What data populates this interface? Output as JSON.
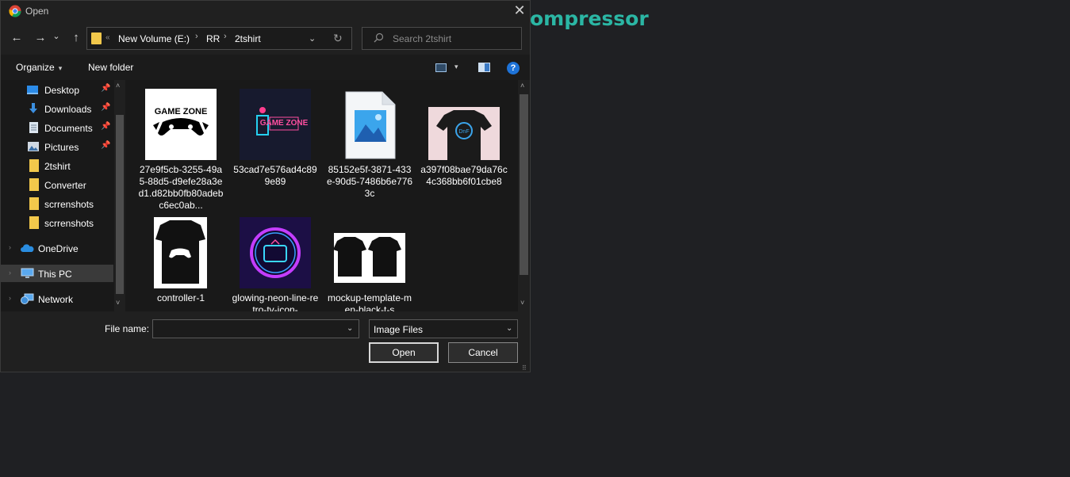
{
  "background": {
    "heading": "ompressor"
  },
  "dialog": {
    "title": "Open",
    "close_glyph": "✕"
  },
  "nav": {
    "back_glyph": "←",
    "forward_glyph": "→",
    "recent_glyph": "⌄",
    "up_glyph": "↑",
    "overflow_glyph": "«",
    "breadcrumbs": [
      "New Volume (E:)",
      "RR",
      "2tshirt"
    ],
    "separator_glyph": "›",
    "dropdown_glyph": "⌄",
    "refresh_glyph": "↻",
    "search_placeholder": "Search 2tshirt"
  },
  "toolbar": {
    "organize": "Organize",
    "caret_glyph": "▾",
    "new_folder": "New folder",
    "help_glyph": "?"
  },
  "sidebar": {
    "items": [
      {
        "label": "Desktop",
        "icon": "desktop-icon",
        "pinned": true
      },
      {
        "label": "Downloads",
        "icon": "download-icon",
        "pinned": true
      },
      {
        "label": "Documents",
        "icon": "document-icon",
        "pinned": true
      },
      {
        "label": "Pictures",
        "icon": "pictures-icon",
        "pinned": true
      },
      {
        "label": "2tshirt",
        "icon": "folder-icon",
        "pinned": false
      },
      {
        "label": "Converter",
        "icon": "folder-icon",
        "pinned": false
      },
      {
        "label": "scrrenshots",
        "icon": "folder-icon",
        "pinned": false
      },
      {
        "label": "scrrenshots",
        "icon": "folder-icon",
        "pinned": false
      },
      {
        "label": "OneDrive",
        "icon": "cloud-icon",
        "pinned": false
      },
      {
        "label": "This PC",
        "icon": "computer-icon",
        "pinned": false,
        "selected": true
      },
      {
        "label": "Network",
        "icon": "network-icon",
        "pinned": false
      }
    ],
    "pin_glyph": "📌",
    "expander_glyph": "›",
    "scroll_up_glyph": "˄",
    "scroll_down_glyph": "˅"
  },
  "files": [
    {
      "name": "27e9f5cb-3255-49a5-88d5-d9efe28a3ed1.d82bb0fb80adebc6ec0ab...",
      "thumb_text": "GAME ZONE"
    },
    {
      "name": "53cad7e576ad4c899e89",
      "thumb_text": "GAME ZONE"
    },
    {
      "name": "85152e5f-3871-433e-90d5-7486b6e7763c",
      "thumb_text": ""
    },
    {
      "name": "a397f08bae79da76c4c368bb6f01cbe8",
      "thumb_text": "DnF"
    },
    {
      "name": "controller-1",
      "thumb_text": ""
    },
    {
      "name": "glowing-neon-line-retro-tv-icon-",
      "thumb_text": ""
    },
    {
      "name": "mockup-template-men-black-t-s",
      "thumb_text": ""
    }
  ],
  "bottom": {
    "file_name_label": "File name:",
    "file_name_value": "",
    "file_type": "Image Files",
    "dropdown_glyph": "⌄",
    "open_label": "Open",
    "cancel_label": "Cancel",
    "grip_glyph": "⠿"
  }
}
